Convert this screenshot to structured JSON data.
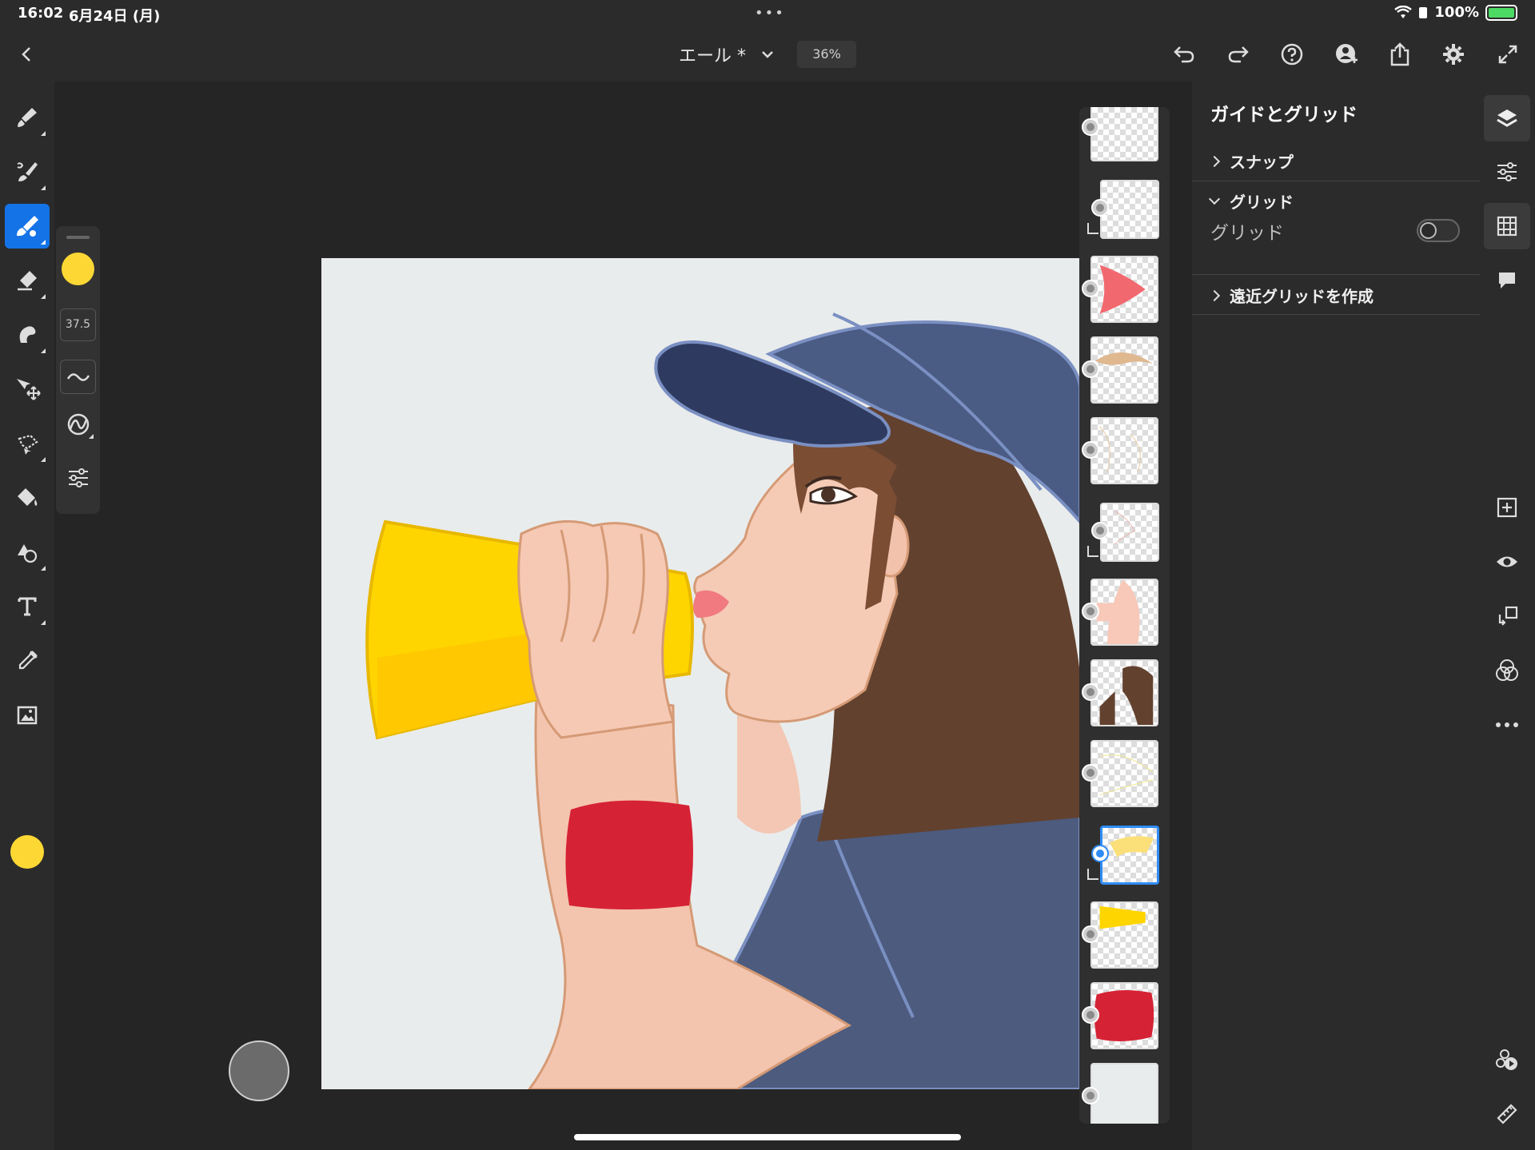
{
  "status": {
    "time": "16:02",
    "date": "6月24日 (月)",
    "dots": "•••",
    "battery": "100%"
  },
  "header": {
    "title": "エール *",
    "zoom": "36%"
  },
  "tools": [
    "paint-brush-tool",
    "smudge-tool",
    "pixel-brush-tool",
    "eraser-tool",
    "liquify-tool",
    "move-tool",
    "selection-tool",
    "fill-tool",
    "shape-tool",
    "text-tool",
    "eyedropper-tool",
    "image-tool"
  ],
  "active_color": "#fdd835",
  "accent_color": "#1473e6",
  "brush": {
    "size": "37.5"
  },
  "panel": {
    "title": "ガイドとグリッド",
    "snap_label": "スナップ",
    "grid_section_label": "グリッド",
    "grid_toggle_label": "グリッド",
    "grid_enabled": false,
    "perspective_label": "遠近グリッドを作成"
  },
  "layers": [
    {
      "name": "layer-1",
      "clipped": false,
      "selected": false
    },
    {
      "name": "layer-2",
      "clipped": true,
      "selected": false
    },
    {
      "name": "layer-lips",
      "clipped": false,
      "selected": false
    },
    {
      "name": "layer-skin-stroke",
      "clipped": false,
      "selected": false
    },
    {
      "name": "layer-sketch",
      "clipped": false,
      "selected": false
    },
    {
      "name": "layer-sketch-2",
      "clipped": true,
      "selected": false
    },
    {
      "name": "layer-skin",
      "clipped": false,
      "selected": false
    },
    {
      "name": "layer-hair",
      "clipped": false,
      "selected": false
    },
    {
      "name": "layer-lines",
      "clipped": false,
      "selected": false
    },
    {
      "name": "layer-highlight",
      "clipped": true,
      "selected": true
    },
    {
      "name": "layer-megaphone",
      "clipped": false,
      "selected": false
    },
    {
      "name": "layer-wristband",
      "clipped": false,
      "selected": false
    },
    {
      "name": "layer-background",
      "clipped": false,
      "selected": false
    }
  ]
}
